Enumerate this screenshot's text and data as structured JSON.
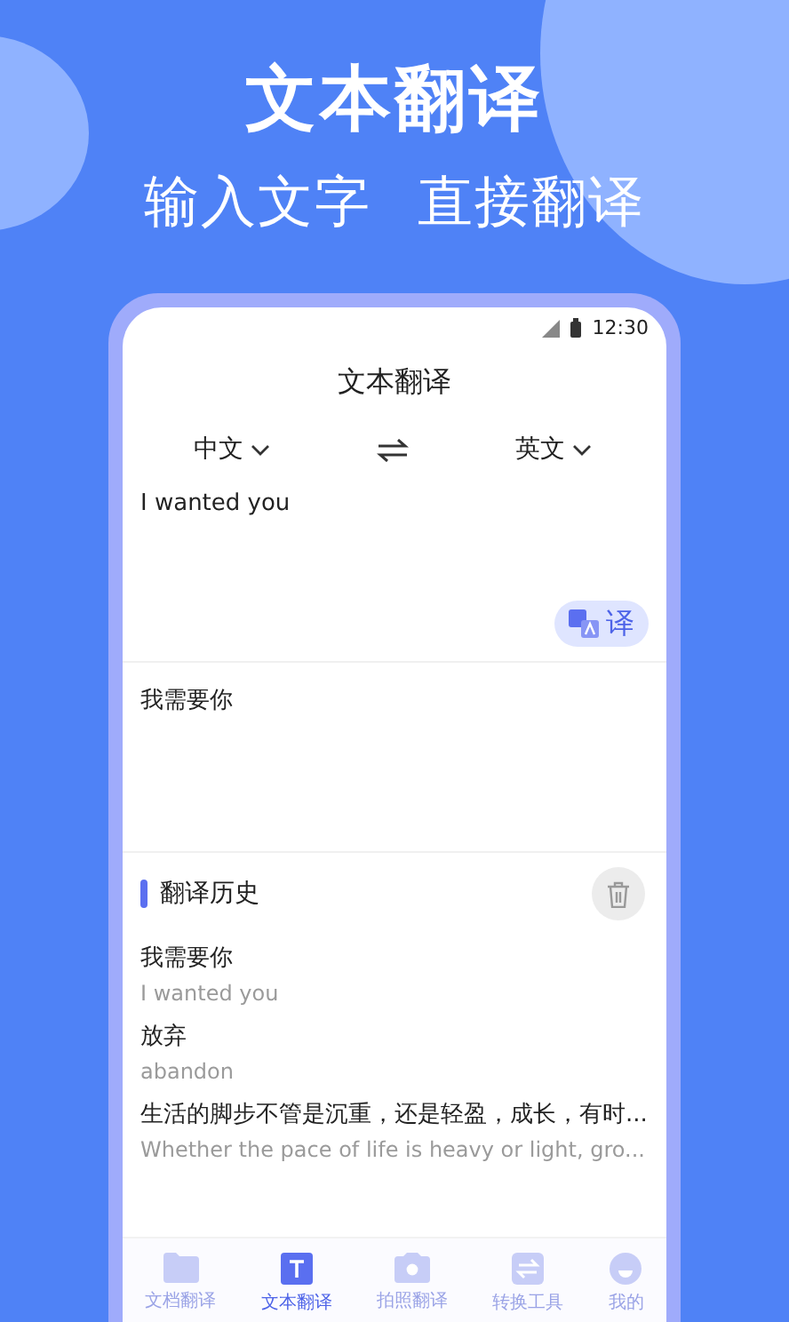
{
  "headline": "文本翻译",
  "taglines": [
    "输入文字",
    "直接翻译"
  ],
  "status_bar": {
    "time": "12:30"
  },
  "screen_title": "文本翻译",
  "languages": {
    "source": "中文",
    "target": "英文"
  },
  "input": {
    "value": "I wanted you"
  },
  "translate_button": {
    "label": "译"
  },
  "output": {
    "text": "我需要你"
  },
  "history": {
    "title": "翻译历史",
    "items": [
      {
        "source": "我需要你",
        "translation": "I wanted you"
      },
      {
        "source": "放弃",
        "translation": "abandon"
      },
      {
        "source": "生活的脚步不管是沉重，还是轻盈，成长，有时...",
        "translation": "Whether the pace of life is heavy or light, gro..."
      }
    ]
  },
  "tabs": [
    {
      "label": "文档翻译",
      "selected": false
    },
    {
      "label": "文本翻译",
      "selected": true
    },
    {
      "label": "拍照翻译",
      "selected": false
    },
    {
      "label": "转换工具",
      "selected": false
    },
    {
      "label": "我的",
      "selected": false
    }
  ]
}
